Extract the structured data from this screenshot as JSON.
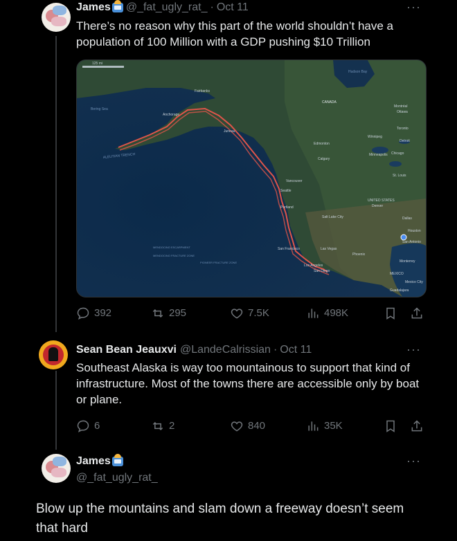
{
  "tweet1": {
    "name": "James",
    "handle": "@_fat_ugly_rat_",
    "time": "Oct 11",
    "text": "There’s no reason why this part of the world shouldn’t have a population of 100 Million with a GDP pushing $10 Trillion",
    "stats": {
      "replies": "392",
      "reposts": "295",
      "likes": "7.5K",
      "views": "498K"
    }
  },
  "map": {
    "scale": "125 mi",
    "places": [
      "Bering Sea",
      "Fairbanks",
      "Anchorage",
      "ALEUTIAN TRENCH",
      "Juneau",
      "CANADA",
      "Hudson Bay",
      "Edmonton",
      "Calgary",
      "Winnipeg",
      "Montréal",
      "Ottawa",
      "Toronto",
      "Minneapolis",
      "Chicago",
      "Detroit",
      "St. Louis",
      "Vancouver",
      "Seattle",
      "Portland",
      "Salt Lake City",
      "UNITED STATES",
      "Denver",
      "Dallas",
      "Houston",
      "San Antonio",
      "San Francisco",
      "Las Vegas",
      "Phoenix",
      "Los Angeles",
      "San Diego",
      "Monterrey",
      "MEXICO",
      "Mexico City",
      "Guadalajara",
      "MENDOCINO ESCARPMENT",
      "MENDOCINO FRACTURE ZONE",
      "PIONEER FRACTURE ZONE"
    ]
  },
  "tweet2": {
    "name": "Sean Bean Jeauxvi",
    "handle": "@LandeCalrissian",
    "time": "Oct 11",
    "text": "Southeast Alaska is way too mountainous to support that kind of infrastructure. Most of the towns there are accessible only by boat or plane.",
    "stats": {
      "replies": "6",
      "reposts": "2",
      "likes": "840",
      "views": "35K"
    }
  },
  "tweet3": {
    "name": "James",
    "handle": "@_fat_ugly_rat_",
    "text": "Blow up the mountains and slam down a freeway doesn’t seem that hard"
  },
  "colors": {
    "background": "#000000",
    "text": "#e7e9ea",
    "muted": "#71767b",
    "route": "#e0554a"
  }
}
